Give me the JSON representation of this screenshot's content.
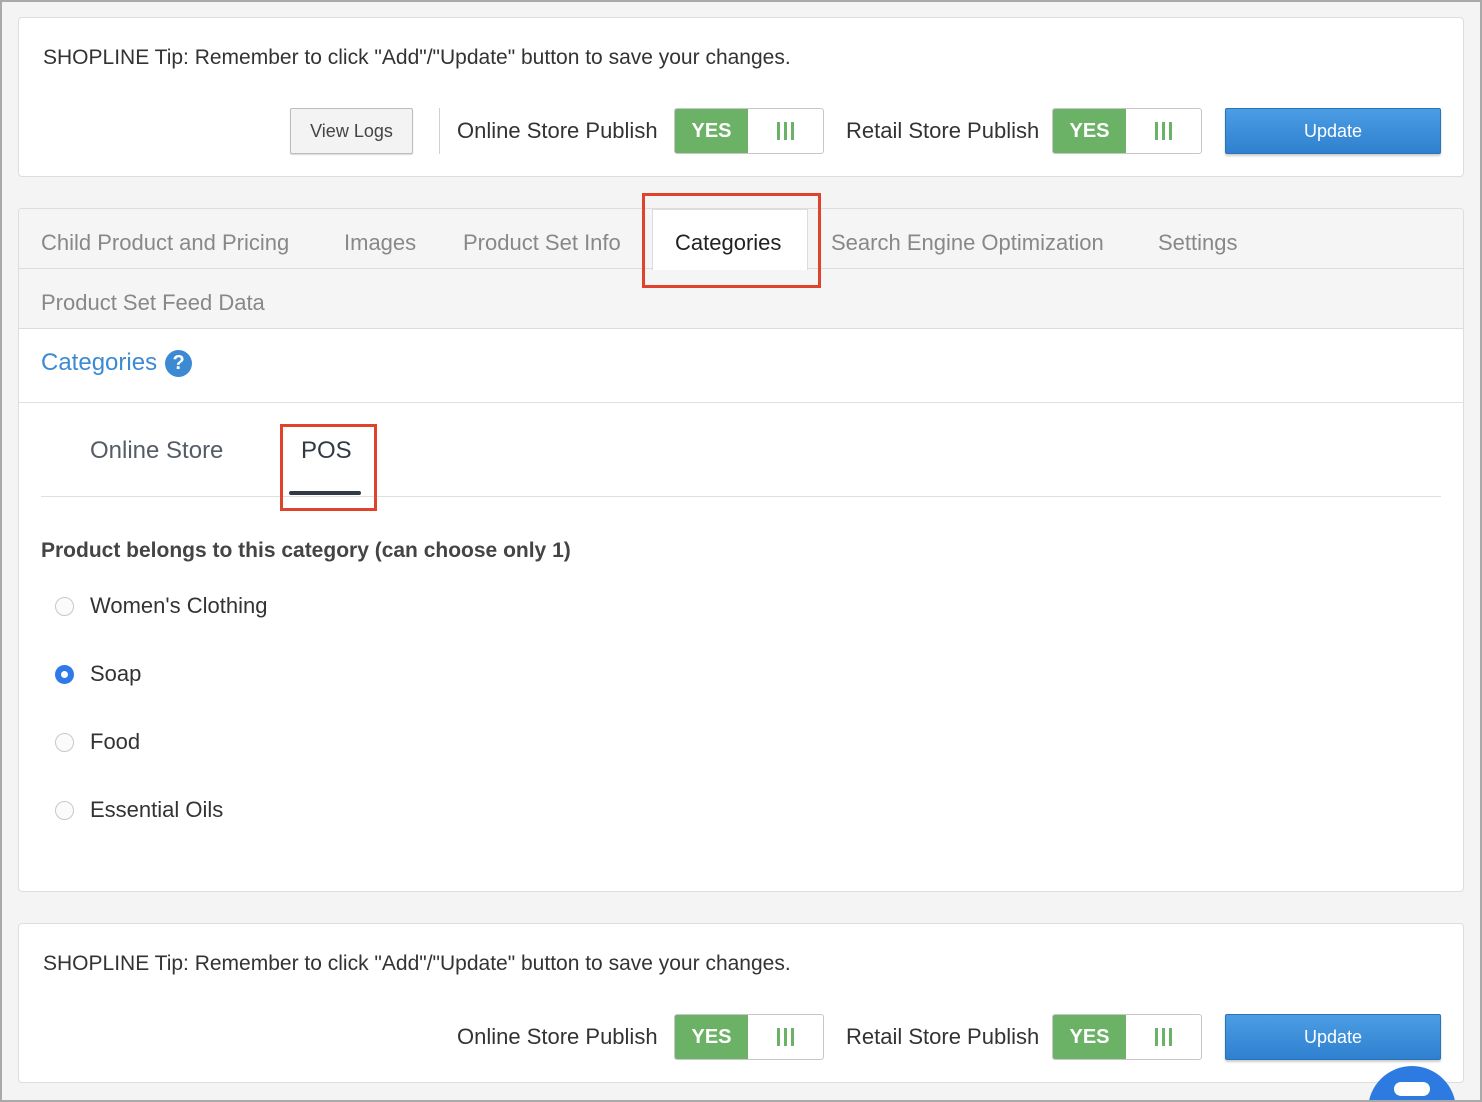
{
  "tip_text": "SHOPLINE Tip: Remember to click \"Add\"/\"Update\" button to save your changes.",
  "top_bar": {
    "view_logs": "View Logs",
    "online_store_publish": "Online Store Publish",
    "retail_store_publish": "Retail Store Publish",
    "online_toggle": "YES",
    "retail_toggle": "YES",
    "update": "Update"
  },
  "tabs": [
    {
      "label": "Child Product and Pricing",
      "active": false
    },
    {
      "label": "Images",
      "active": false
    },
    {
      "label": "Product Set Info",
      "active": false
    },
    {
      "label": "Categories",
      "active": true
    },
    {
      "label": "Search Engine Optimization",
      "active": false
    },
    {
      "label": "Settings",
      "active": false
    },
    {
      "label": "Product Set Feed Data",
      "active": false
    }
  ],
  "section": {
    "title": "Categories",
    "help_icon": "?"
  },
  "subtabs": [
    {
      "label": "Online Store",
      "active": false
    },
    {
      "label": "POS",
      "active": true
    }
  ],
  "question": "Product belongs to this category (can choose only 1)",
  "options": [
    {
      "label": "Women's Clothing",
      "checked": false
    },
    {
      "label": "Soap",
      "checked": true
    },
    {
      "label": "Food",
      "checked": false
    },
    {
      "label": "Essential Oils",
      "checked": false
    }
  ],
  "bottom_bar": {
    "online_store_publish": "Online Store Publish",
    "retail_store_publish": "Retail Store Publish",
    "online_toggle": "YES",
    "retail_toggle": "YES",
    "update": "Update"
  },
  "colors": {
    "accent_blue": "#3d8ad4",
    "toggle_green": "#6bb266",
    "highlight_red": "#e0432c"
  }
}
